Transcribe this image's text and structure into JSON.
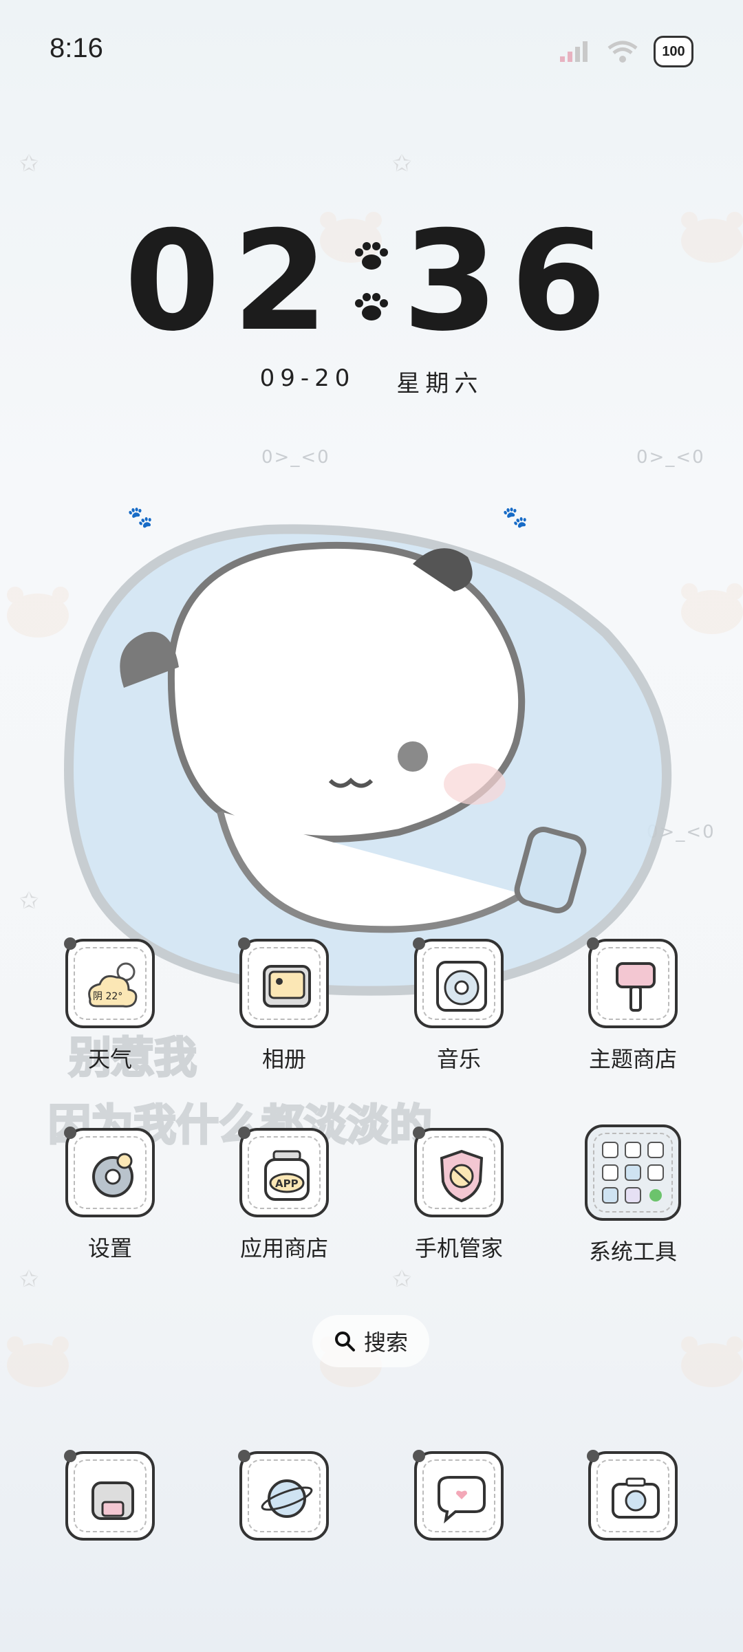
{
  "status_bar": {
    "time": "8:16",
    "battery_level": "100",
    "icons": [
      "signal-icon",
      "wifi-icon",
      "battery-icon"
    ]
  },
  "clock_widget": {
    "hour": "02",
    "minute": "36",
    "date": "09-20",
    "weekday": "星期六"
  },
  "weather_badge": "阴 22°",
  "wallpaper": {
    "caption_line1": "别惹我",
    "caption_line2": "因为我什么都淡淡的",
    "emoticon": "0>_<0"
  },
  "apps": [
    {
      "label": "天气",
      "icon": "weather-cloud-icon"
    },
    {
      "label": "相册",
      "icon": "photo-album-icon"
    },
    {
      "label": "音乐",
      "icon": "music-disc-icon"
    },
    {
      "label": "主题商店",
      "icon": "theme-brush-icon"
    },
    {
      "label": "设置",
      "icon": "settings-gear-icon"
    },
    {
      "label": "应用商店",
      "icon": "app-store-jar-icon"
    },
    {
      "label": "手机管家",
      "icon": "phone-manager-shield-icon"
    },
    {
      "label": "系统工具",
      "icon": "system-tools-folder-icon"
    }
  ],
  "search": {
    "label": "搜索"
  },
  "dock": [
    {
      "icon": "phone-dialer-icon"
    },
    {
      "icon": "browser-planet-icon"
    },
    {
      "icon": "messages-bubble-icon"
    },
    {
      "icon": "camera-icon"
    }
  ],
  "colors": {
    "accent_pink": "#f1c4cf",
    "hero_blue": "#cfe3f2",
    "text_dark": "#222222"
  }
}
